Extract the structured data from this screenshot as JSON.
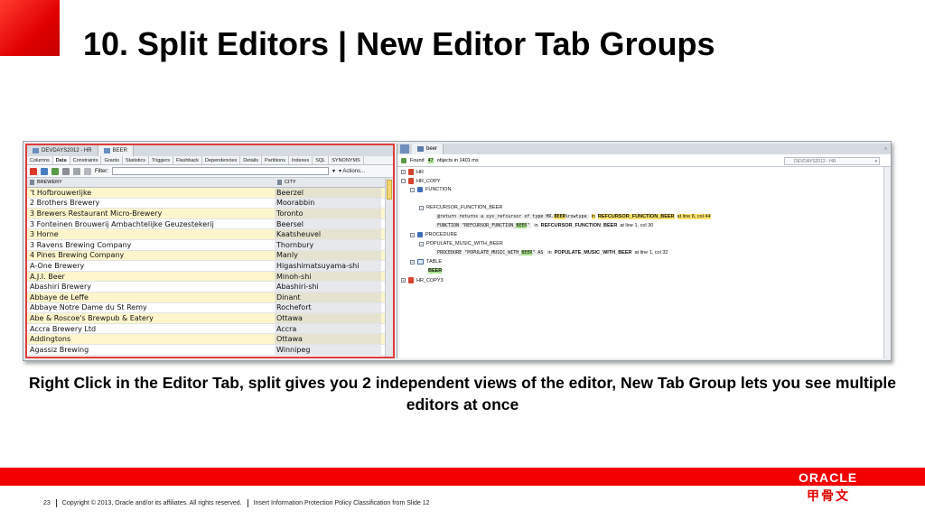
{
  "slide": {
    "title": "10. Split Editors | New Editor Tab Groups",
    "subtitle": "Right Click in the Editor Tab, split gives you 2 independent views of the editor, New Tab Group lets you see multiple editors at once",
    "footer": {
      "page_number": "23",
      "copyright": "Copyright © 2013, Oracle and/or its affiliates. All rights reserved.",
      "classification": "Insert Information Protection Policy Classification from Slide 12"
    },
    "brand": {
      "logo_text": "ORACLE",
      "chinese_text": "甲骨文",
      "brand_red": "#f20000"
    }
  },
  "left_editor": {
    "doc_tabs": [
      "DEVDAYS2012 - HR",
      "BEER"
    ],
    "sub_tabs": [
      "Columns",
      "Data",
      "Constraints",
      "Grants",
      "Statistics",
      "Triggers",
      "Flashback",
      "Dependencies",
      "Details",
      "Partitions",
      "Indexes",
      "SQL",
      "SYNONYMS"
    ],
    "active_sub_tab": "Data",
    "filter_label": "Filter:",
    "actions_label": "Actions...",
    "columns": [
      "BREWERY",
      "CITY"
    ],
    "rows": [
      [
        "'t Hofbrouwerijke",
        "Beerzel"
      ],
      [
        "2 Brothers Brewery",
        "Moorabbin"
      ],
      [
        "3 Brewers Restaurant Micro-Brewery",
        "Toronto"
      ],
      [
        "3 Fonteinen Brouwerij Ambachtelijke Geuzestekerij",
        "Beersel"
      ],
      [
        "3 Horne",
        "Kaatsheuvel"
      ],
      [
        "3 Ravens Brewing Company",
        "Thornbury"
      ],
      [
        "4 Pines Brewing Company",
        "Manly"
      ],
      [
        "A-One Brewery",
        "Higashimatsuyama-shi"
      ],
      [
        "A.J.I. Beer",
        "Minoh-shi"
      ],
      [
        "Abashiri Brewery",
        "Abashiri-shi"
      ],
      [
        "Abbaye de Leffe",
        "Dinant"
      ],
      [
        "Abbaye Notre Dame du St Remy",
        "Rochefort"
      ],
      [
        "Abe & Roscoe's Brewpub & Eatery",
        "Ottawa"
      ],
      [
        "Accra Brewery Ltd",
        "Accra"
      ],
      [
        "Addingtons",
        "Ottawa"
      ],
      [
        "Agassiz Brewing",
        "Winnipeg"
      ]
    ]
  },
  "right_editor": {
    "tab_label": "beer",
    "found_text": "Found",
    "found_count": "47",
    "found_suffix": "objects in 1401 ms",
    "connection": "DEVDAYS2012 - HR",
    "tree": {
      "hr": "HR",
      "hr_copy": "HR_COPY",
      "function": "FUNCTION",
      "refcursor_function_beer": "REFCURSOR_FUNCTION_BEER",
      "line1_code_pre": "@return returns a sys_refcursor of type HR.",
      "line1_code_hl": "BEER",
      "line1_code_post": "%rowtype",
      "line1_in": "in",
      "line1_obj": "REFCURSOR_FUNCTION_BEER",
      "line1_pos": "at line 8, col 44",
      "line2_code_pre": "FUNCTION \"REFCURSOR_FUNCTION_",
      "line2_code_hl": "BEER",
      "line2_code_post": "\"",
      "line2_in": "in",
      "line2_obj": "REFCURSOR_FUNCTION_BEER",
      "line2_pos": "at line 1, col 30",
      "procedure": "PROCEDURE",
      "populate_music_with_beer": "POPULATE_MUSIC_WITH_BEER",
      "line3_code_pre": "PROCEDURE \"POPULATE_MUSIC_WITH_",
      "line3_code_hl": "BEER",
      "line3_code_post": "\" AS",
      "line3_in": "in",
      "line3_obj": "POPULATE_MUSIC_WITH_BEER",
      "line3_pos": "at line 1, col 32",
      "table": "TABLE",
      "beer": "BEER",
      "hr_copy3": "HR_COPY3"
    }
  }
}
